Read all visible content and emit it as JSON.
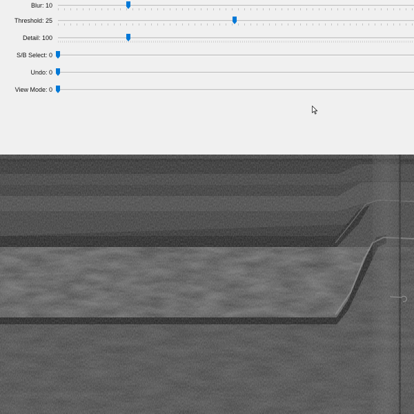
{
  "controls": {
    "sliders": [
      {
        "label": "Blur: 10",
        "value": 10,
        "max": 50
      },
      {
        "label": "Threshold: 25",
        "value": 25,
        "max": 50
      },
      {
        "label": "Detail: 100",
        "value": 100,
        "max": 500
      },
      {
        "label": "S/B Select: 0",
        "value": 0,
        "max": 10
      },
      {
        "label": "Undo: 0",
        "value": 0,
        "max": 10
      },
      {
        "label": "View Mode: 0",
        "value": 0,
        "max": 10
      }
    ]
  },
  "colors": {
    "panel_bg": "#f0f0f0",
    "thumb": "#0078d7",
    "image_bg": "#2a2a2a"
  },
  "icons": {
    "cursor": "arrow-cursor-icon"
  }
}
